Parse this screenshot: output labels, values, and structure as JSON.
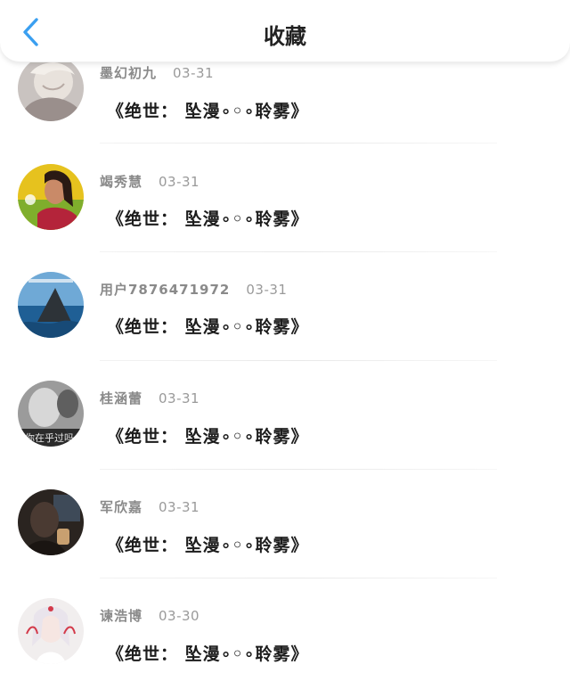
{
  "header": {
    "title": "收藏",
    "back_icon": "chevron-left-icon",
    "accent": "#3a9ff0"
  },
  "favorites": [
    {
      "name": "墨幻初九",
      "date": "03-31",
      "content": "《绝世： 坠漫∘◦∘聆雾》",
      "avatar": "gray-anime-portrait"
    },
    {
      "name": "竭秀慧",
      "date": "03-31",
      "content": "《绝世： 坠漫∘◦∘聆雾》",
      "avatar": "woman-yellow-background"
    },
    {
      "name": "用户7876471972",
      "date": "03-31",
      "content": "《绝世： 坠漫∘◦∘聆雾》",
      "avatar": "shark-fin-sea"
    },
    {
      "name": "桂涵蕾",
      "date": "03-31",
      "content": "《绝世： 坠漫∘◦∘聆雾》",
      "avatar": "monochrome-photo",
      "avatar_caption": "你在乎过吗"
    },
    {
      "name": "军欣嘉",
      "date": "03-31",
      "content": "《绝世： 坠漫∘◦∘聆雾》",
      "avatar": "dark-car-interior"
    },
    {
      "name": "谏浩博",
      "date": "03-30",
      "content": "《绝世： 坠漫∘◦∘聆雾》",
      "avatar": "anime-girl-white"
    }
  ]
}
